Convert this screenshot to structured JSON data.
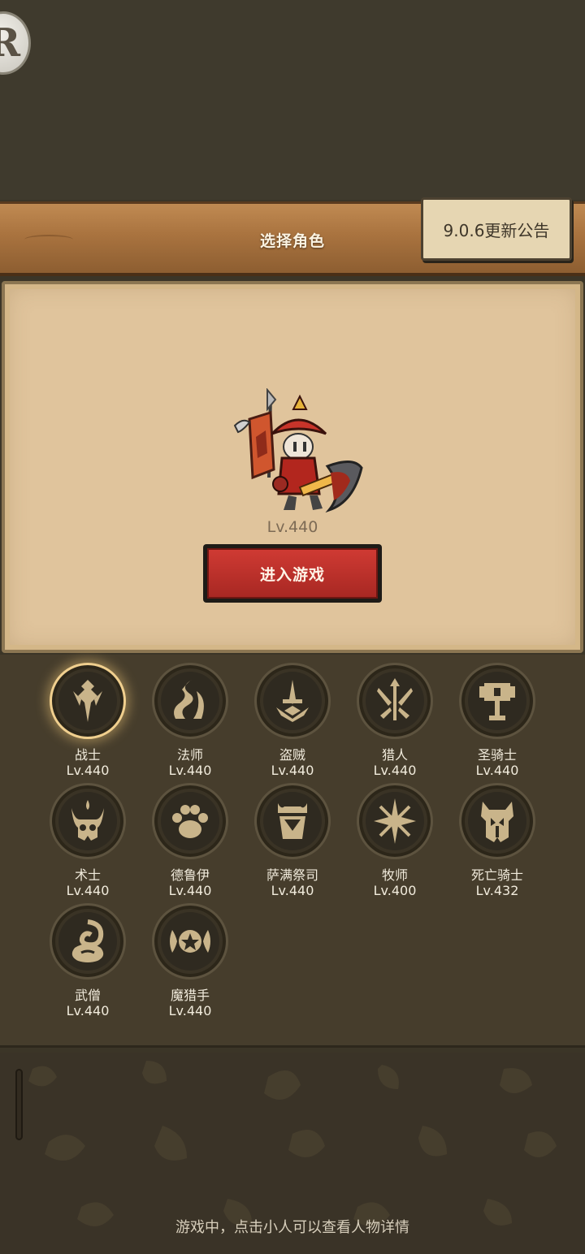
{
  "header": {
    "title": "选择角色",
    "notice_button": "9.0.6更新公告"
  },
  "selected_hero": {
    "level": "Lv.440",
    "enter_button": "进入游戏"
  },
  "classes": [
    {
      "name": "战士",
      "level": "Lv.440",
      "icon": "warrior-emblem",
      "selected": true
    },
    {
      "name": "法师",
      "level": "Lv.440",
      "icon": "mage-emblem"
    },
    {
      "name": "盗贼",
      "level": "Lv.440",
      "icon": "rogue-emblem"
    },
    {
      "name": "猎人",
      "level": "Lv.440",
      "icon": "hunter-emblem"
    },
    {
      "name": "圣骑士",
      "level": "Lv.440",
      "icon": "paladin-emblem"
    },
    {
      "name": "术士",
      "level": "Lv.440",
      "icon": "warlock-emblem"
    },
    {
      "name": "德鲁伊",
      "level": "Lv.440",
      "icon": "druid-emblem"
    },
    {
      "name": "萨满祭司",
      "level": "Lv.440",
      "icon": "shaman-emblem"
    },
    {
      "name": "牧师",
      "level": "Lv.400",
      "icon": "priest-emblem"
    },
    {
      "name": "死亡骑士",
      "level": "Lv.432",
      "icon": "death-knight-emblem"
    },
    {
      "name": "武僧",
      "level": "Lv.440",
      "icon": "monk-emblem"
    },
    {
      "name": "魔猎手",
      "level": "Lv.440",
      "icon": "demon-hunter-emblem"
    }
  ],
  "footer": {
    "hint": "游戏中，点击小人可以查看人物详情"
  },
  "colors": {
    "emblem": "#c9b48a",
    "selected_glow": "#f0cf8e",
    "enter_button": "#b82e28"
  }
}
